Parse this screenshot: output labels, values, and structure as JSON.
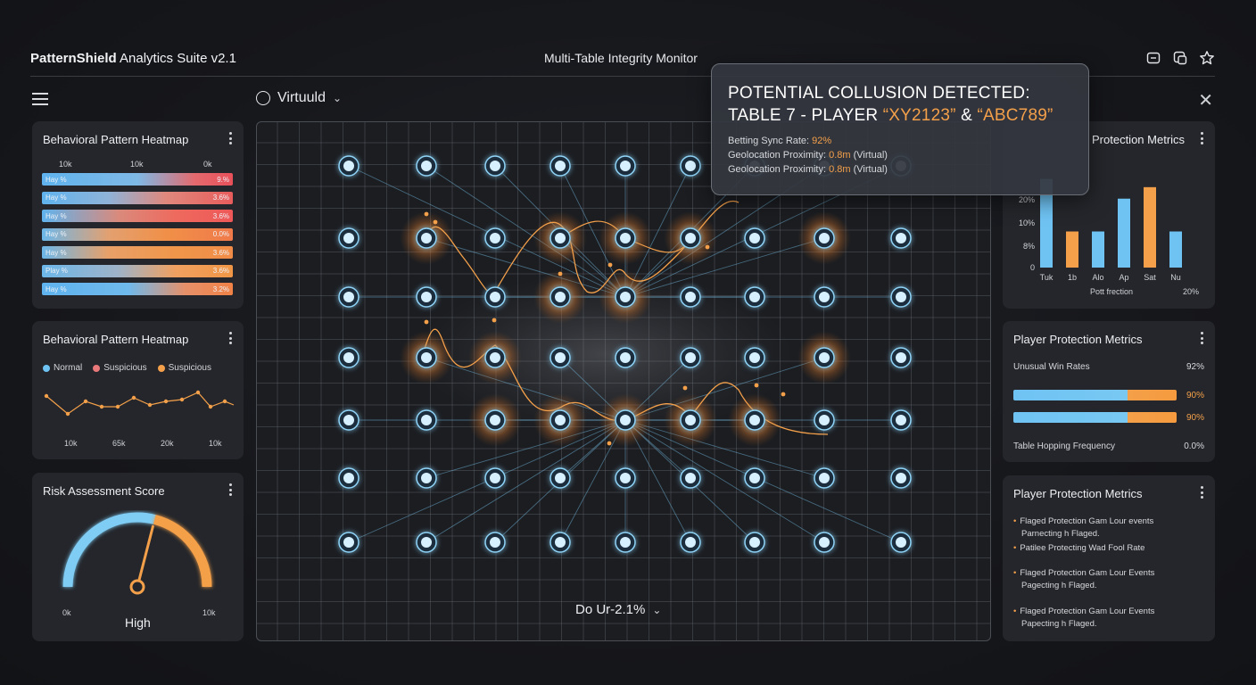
{
  "header": {
    "app_title_bold": "PatternShield",
    "app_title_rest": " Analytics Suite v2.1",
    "center_title": "Multi-Table Integrity Monitor",
    "icons": [
      "window-icon",
      "copy-icon",
      "star-icon"
    ]
  },
  "toolbar": {
    "dropdown_label": "Virtuuld"
  },
  "heatmap_panel": {
    "title": "Behavioral Pattern Heatmap",
    "col_headers": [
      "10k",
      "10k",
      "0k"
    ],
    "rows": [
      {
        "label": "Hay %",
        "value": "9.%"
      },
      {
        "label": "Hay %",
        "value": "3.6%"
      },
      {
        "label": "Hay %",
        "value": "3.6%"
      },
      {
        "label": "Hay %",
        "value": "0.0%"
      },
      {
        "label": "Hay %",
        "value": "3.6%"
      },
      {
        "label": "Play %",
        "value": "3.6%"
      },
      {
        "label": "Hay %",
        "value": "3.2%"
      }
    ]
  },
  "pattern_panel": {
    "title": "Behavioral Pattern Heatmap",
    "legend": [
      {
        "label": "Normal",
        "color": "#6fc3f3"
      },
      {
        "label": "Suspicious",
        "color": "#e8787a"
      },
      {
        "label": "Suspicious",
        "color": "#f4a04a"
      }
    ],
    "x_labels": [
      "10k",
      "65k",
      "20k",
      "10k"
    ]
  },
  "risk_panel": {
    "title": "Risk Assessment Score",
    "min_label": "0k",
    "max_label": "10k",
    "level": "High",
    "needle_fraction": 0.58
  },
  "main": {
    "footer_label": "Do Ur-2.1%"
  },
  "alert": {
    "title_line1": "POTENTIAL COLLUSION DETECTED:",
    "title_line2_pre": "TABLE 7 - PLAYER ",
    "player1": "“XY2123”",
    "amp": " & ",
    "player2": "“ABC789”",
    "line1_label": "Betting Sync Rate: ",
    "line1_value": "92%",
    "line2_label": "Geolocation Proximity: ",
    "line2_value": "0.8m",
    "line2_suffix": " (Virtual)",
    "line3_label": "Geolocation Proximity: ",
    "line3_value": "0.8m",
    "line3_suffix": " (Virtual)"
  },
  "bar_panel": {
    "title": "Protection Metrics",
    "chart_data": {
      "type": "bar",
      "categories": [
        "Tuk",
        "1b",
        "Alo",
        "Ap",
        "Sat",
        "Nu"
      ],
      "values": [
        27,
        11,
        11,
        21,
        24.5,
        11
      ],
      "colors": [
        "#6fc3f3",
        "#f4a04a",
        "#6fc3f3",
        "#6fc3f3",
        "#f4a04a",
        "#6fc3f3"
      ],
      "y_ticks": [
        "20%",
        "10%",
        "8%",
        "0"
      ],
      "ylim": [
        0,
        25
      ],
      "xlabel": "Pott frection",
      "xlabel_value": "20%"
    }
  },
  "protection_panel": {
    "title": "Player Protection Metrics",
    "row1_label": "Unusual Win Rates",
    "row1_value": "92%",
    "bar1_value": "90%",
    "bar2_value": "90%",
    "row2_label": "Table Hopping Frequency",
    "row2_value": "0.0%"
  },
  "flags_panel": {
    "title": "Player Protection Metrics",
    "items": [
      {
        "line1": "Flaged Protection Gam Lour events",
        "line2": "Parnecting h Flaged."
      },
      {
        "line1": "Patilee Protecting Wad Fool Rate",
        "line2": ""
      },
      {
        "line1": "Flaged Protection Gam Lour Events",
        "line2": "Pagecting h Flaged."
      },
      {
        "line1": "Flaged Protection Gam Lour Events",
        "line2": "Papecting h Flaged."
      }
    ]
  }
}
